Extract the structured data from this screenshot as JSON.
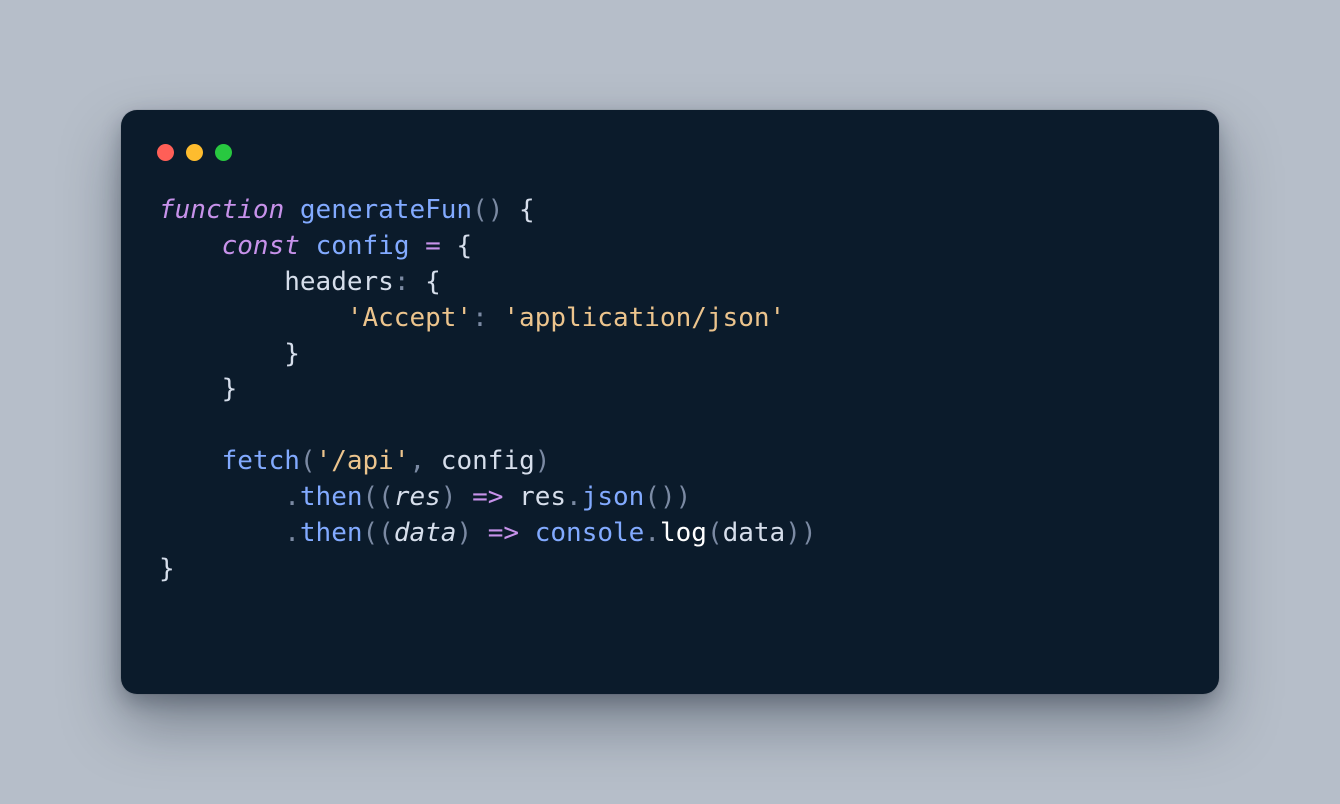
{
  "colors": {
    "background": "#b6bec9",
    "window": "#0b1b2b",
    "red": "#ff5f57",
    "yellow": "#febc2e",
    "green": "#28c840",
    "keyword": "#c792ea",
    "function": "#82aaff",
    "identifier": "#d6deeb",
    "string": "#ecc48d",
    "punct": "#7b8aa3"
  },
  "language": "javascript",
  "code_plain": "function generateFun() {\n    const config = {\n        headers: {\n            'Accept': 'application/json'\n        }\n    }\n\n    fetch('/api', config)\n        .then((res) => res.json())\n        .then((data) => console.log(data))\n}",
  "code": {
    "lines": [
      [
        {
          "c": "tok-kw",
          "t": "function"
        },
        {
          "c": "",
          "t": " "
        },
        {
          "c": "tok-fn",
          "t": "generateFun"
        },
        {
          "c": "tok-punct",
          "t": "("
        },
        {
          "c": "tok-punct",
          "t": ")"
        },
        {
          "c": "",
          "t": " "
        },
        {
          "c": "tok-brace",
          "t": "{"
        }
      ],
      [
        {
          "c": "",
          "t": "    "
        },
        {
          "c": "tok-kw",
          "t": "const"
        },
        {
          "c": "",
          "t": " "
        },
        {
          "c": "tok-var",
          "t": "config"
        },
        {
          "c": "",
          "t": " "
        },
        {
          "c": "tok-op",
          "t": "="
        },
        {
          "c": "",
          "t": " "
        },
        {
          "c": "tok-brace",
          "t": "{"
        }
      ],
      [
        {
          "c": "",
          "t": "        "
        },
        {
          "c": "tok-prop",
          "t": "headers"
        },
        {
          "c": "tok-punct",
          "t": ":"
        },
        {
          "c": "",
          "t": " "
        },
        {
          "c": "tok-brace",
          "t": "{"
        }
      ],
      [
        {
          "c": "",
          "t": "            "
        },
        {
          "c": "tok-str",
          "t": "'Accept'"
        },
        {
          "c": "tok-punct",
          "t": ":"
        },
        {
          "c": "",
          "t": " "
        },
        {
          "c": "tok-str",
          "t": "'application/json'"
        }
      ],
      [
        {
          "c": "",
          "t": "        "
        },
        {
          "c": "tok-brace",
          "t": "}"
        }
      ],
      [
        {
          "c": "",
          "t": "    "
        },
        {
          "c": "tok-brace",
          "t": "}"
        }
      ],
      [
        {
          "c": "",
          "t": ""
        }
      ],
      [
        {
          "c": "",
          "t": "    "
        },
        {
          "c": "tok-fn",
          "t": "fetch"
        },
        {
          "c": "tok-punct",
          "t": "("
        },
        {
          "c": "tok-str",
          "t": "'/api'"
        },
        {
          "c": "tok-punct",
          "t": ","
        },
        {
          "c": "",
          "t": " "
        },
        {
          "c": "tok-ident",
          "t": "config"
        },
        {
          "c": "tok-punct",
          "t": ")"
        }
      ],
      [
        {
          "c": "",
          "t": "        "
        },
        {
          "c": "tok-dot",
          "t": "."
        },
        {
          "c": "tok-fn",
          "t": "then"
        },
        {
          "c": "tok-punct",
          "t": "("
        },
        {
          "c": "tok-punct",
          "t": "("
        },
        {
          "c": "tok-param",
          "t": "res"
        },
        {
          "c": "tok-punct",
          "t": ")"
        },
        {
          "c": "",
          "t": " "
        },
        {
          "c": "tok-op",
          "t": "=>"
        },
        {
          "c": "",
          "t": " "
        },
        {
          "c": "tok-ident",
          "t": "res"
        },
        {
          "c": "tok-dot",
          "t": "."
        },
        {
          "c": "tok-fn",
          "t": "json"
        },
        {
          "c": "tok-punct",
          "t": "("
        },
        {
          "c": "tok-punct",
          "t": ")"
        },
        {
          "c": "tok-punct",
          "t": ")"
        }
      ],
      [
        {
          "c": "",
          "t": "        "
        },
        {
          "c": "tok-dot",
          "t": "."
        },
        {
          "c": "tok-fn",
          "t": "then"
        },
        {
          "c": "tok-punct",
          "t": "("
        },
        {
          "c": "tok-punct",
          "t": "("
        },
        {
          "c": "tok-param",
          "t": "data"
        },
        {
          "c": "tok-punct",
          "t": ")"
        },
        {
          "c": "",
          "t": " "
        },
        {
          "c": "tok-op",
          "t": "=>"
        },
        {
          "c": "",
          "t": " "
        },
        {
          "c": "tok-obj",
          "t": "console"
        },
        {
          "c": "tok-dot",
          "t": "."
        },
        {
          "c": "tok-white",
          "t": "log"
        },
        {
          "c": "tok-punct",
          "t": "("
        },
        {
          "c": "tok-ident",
          "t": "data"
        },
        {
          "c": "tok-punct",
          "t": ")"
        },
        {
          "c": "tok-punct",
          "t": ")"
        }
      ],
      [
        {
          "c": "tok-brace",
          "t": "}"
        }
      ]
    ]
  }
}
